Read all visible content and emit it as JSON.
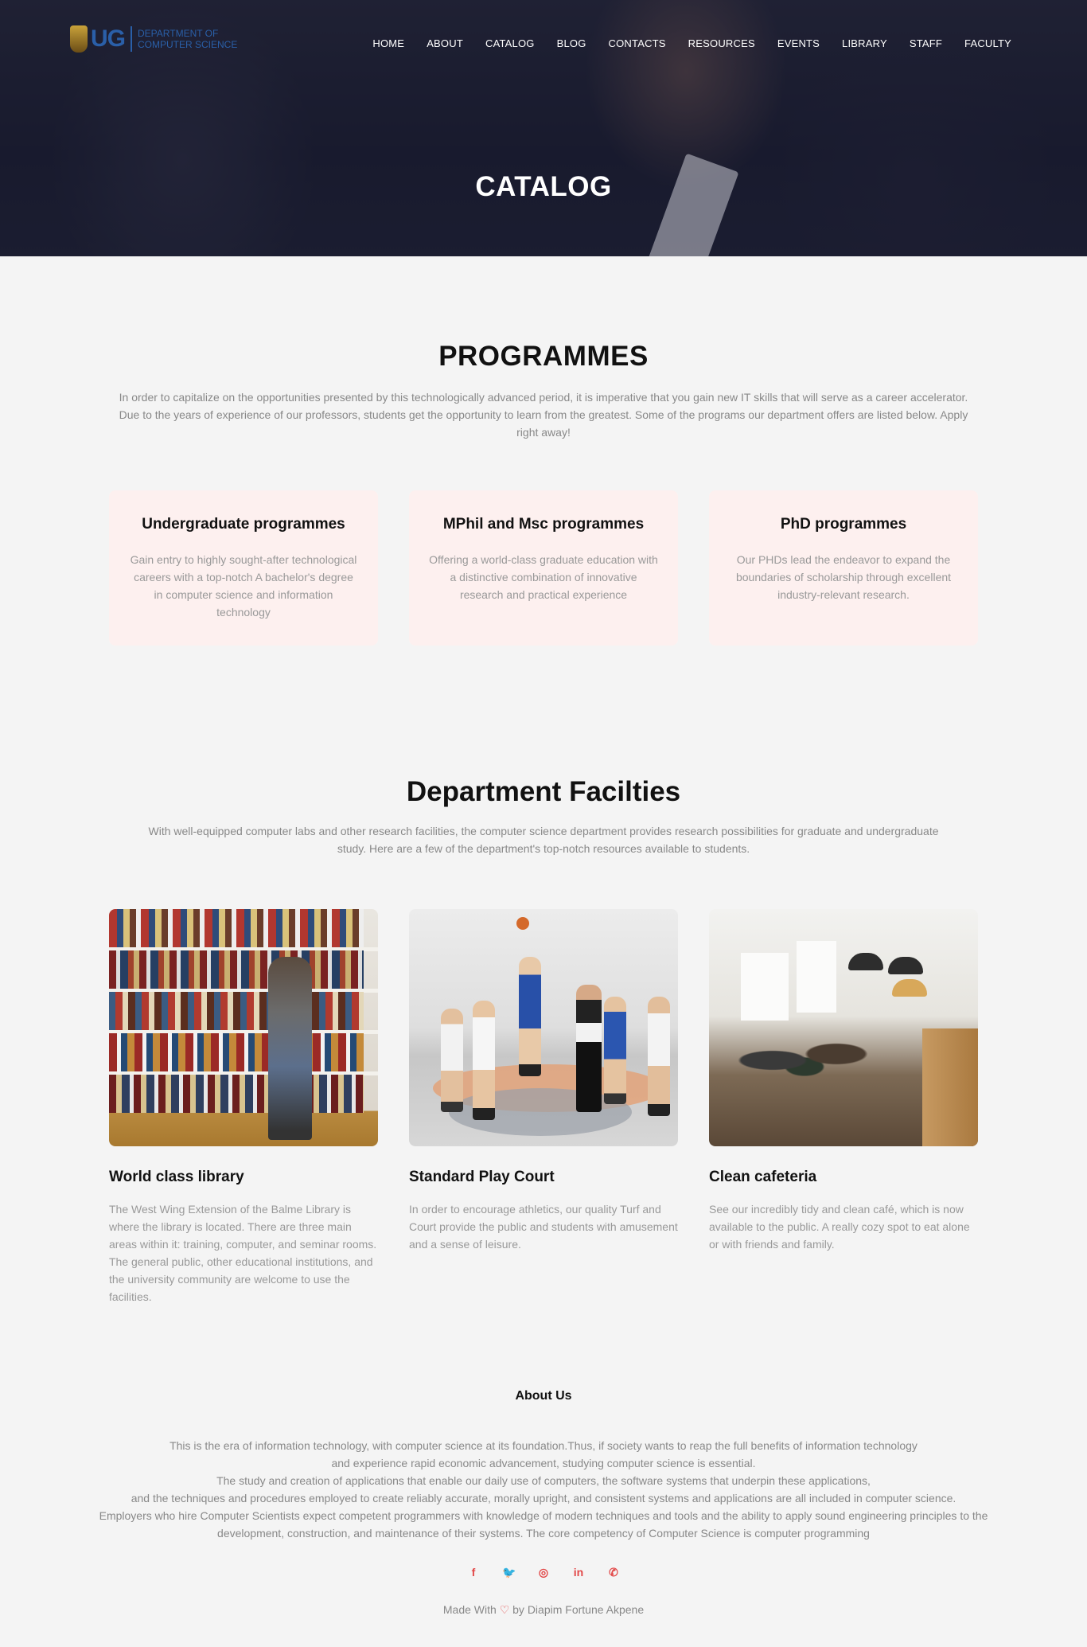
{
  "header": {
    "logo_abbr": "UG",
    "logo_text_line1": "DEPARTMENT OF",
    "logo_text_line2": "COMPUTER SCIENCE",
    "nav": [
      "HOME",
      "ABOUT",
      "CATALOG",
      "BLOG",
      "CONTACTS",
      "RESOURCES",
      "EVENTS",
      "LIBRARY",
      "STAFF",
      "FACULTY"
    ],
    "hero_title": "CATALOG"
  },
  "programmes": {
    "title": "PROGRAMMES",
    "intro": "In order to capitalize on the opportunities presented by this technologically advanced period, it is imperative that you gain new IT skills that will serve as a career accelerator. Due to the years of experience of our professors, students get the opportunity to learn from the greatest. Some of the programs our department offers are listed below. Apply right away!",
    "cards": [
      {
        "title": "Undergraduate programmes",
        "text": "Gain entry to highly sought-after technological careers with a top-notch A bachelor's degree in computer science and information technology"
      },
      {
        "title": "MPhil and Msc programmes",
        "text": "Offering a world-class graduate education with a distinctive combination of innovative research and practical experience"
      },
      {
        "title": "PhD programmes",
        "text": "Our PHDs lead the endeavor to expand the boundaries of scholarship through excellent industry-relevant research."
      }
    ]
  },
  "facilities": {
    "title": "Department Facilties",
    "intro": "With well-equipped computer labs and other research facilities, the computer science department provides research possibilities for graduate and undergraduate study. Here are a few of the department's top-notch resources available to students.",
    "cards": [
      {
        "title": "World class library",
        "text": "The West Wing Extension of the Balme Library is where the library is located. There are three main areas within it: training, computer, and seminar rooms. The general public, other educational institutions, and the university community are welcome to use the facilities."
      },
      {
        "title": "Standard Play Court",
        "text": "In order to encourage athletics, our quality Turf and Court provide the public and students with amusement and a sense of leisure."
      },
      {
        "title": "Clean cafeteria",
        "text": "See our incredibly tidy and clean café, which is now available to the public. A really cozy spot to eat alone or with friends and family."
      }
    ]
  },
  "footer": {
    "title": "About Us",
    "lines": [
      "This is the era of information technology, with computer science at its foundation.Thus, if society wants to reap the full benefits of information technology",
      "and experience rapid economic advancement, studying computer science is essential.",
      "The study and creation of applications that enable our daily use of computers, the software systems that underpin these applications,",
      "and the techniques and procedures employed to create reliably accurate, morally upright, and consistent systems and applications are all included in computer science.",
      "Employers who hire Computer Scientists expect competent programmers with knowledge of modern techniques and tools and the ability to apply sound engineering principles to the",
      "development, construction, and maintenance of their systems. The core competency of Computer Science is computer programming"
    ],
    "socials": [
      {
        "icon": "facebook-icon",
        "glyph": "f"
      },
      {
        "icon": "twitter-icon",
        "glyph": "🐦"
      },
      {
        "icon": "instagram-icon",
        "glyph": "◎"
      },
      {
        "icon": "linkedin-icon",
        "glyph": "in"
      },
      {
        "icon": "whatsapp-icon",
        "glyph": "✆"
      }
    ],
    "made_with_prefix": "Made With",
    "made_with_heart": "♡",
    "made_with_suffix": "by Diapim Fortune Akpene",
    "accent_color": "#e24848"
  }
}
